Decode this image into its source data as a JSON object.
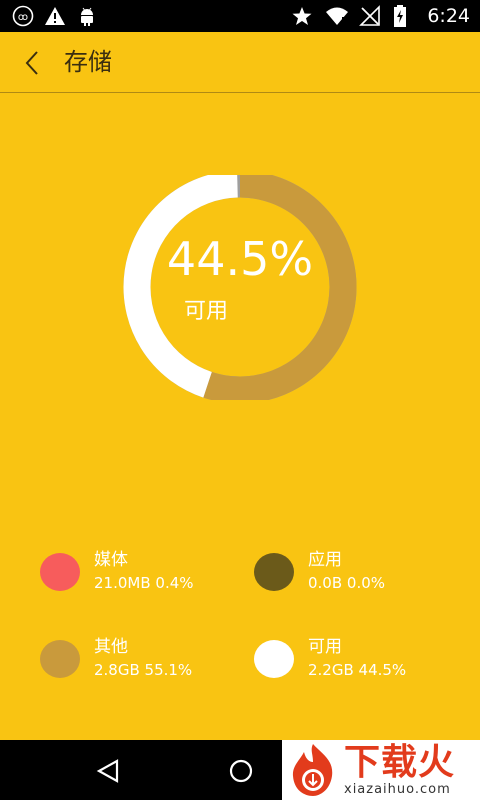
{
  "status_bar": {
    "time": "6:24",
    "icons_left": [
      "custom-app-icon",
      "warning-icon",
      "android-icon"
    ],
    "icons_right": [
      "star-icon",
      "wifi-icon",
      "no-signal-icon",
      "battery-charging-icon"
    ]
  },
  "header": {
    "title": "存储",
    "back_icon": "chevron-left-icon"
  },
  "storage_chart": {
    "percent_label": "44.5%",
    "available_label": "可用"
  },
  "chart_data": {
    "type": "pie",
    "categories": [
      "媒体",
      "应用",
      "其他",
      "可用"
    ],
    "values": [
      0.4,
      0.0,
      55.1,
      44.5
    ],
    "colors": [
      "#F75C5C",
      "#6B5A1A",
      "#C99A3C",
      "#FFFFFF"
    ]
  },
  "legend": [
    {
      "name": "媒体",
      "value": "21.0MB 0.4%",
      "color": "#F75C5C"
    },
    {
      "name": "应用",
      "value": "0.0B 0.0%",
      "color": "#6B5A1A"
    },
    {
      "name": "其他",
      "value": "2.8GB 55.1%",
      "color": "#C99A3C"
    },
    {
      "name": "可用",
      "value": "2.2GB 44.5%",
      "color": "#FFFFFF"
    }
  ],
  "colors": {
    "background": "#F9C412",
    "status_bar": "#000000",
    "chart_track": "#9E9E9E",
    "watermark_red": "#E23B1C"
  },
  "watermark": {
    "text": "下载火",
    "sub": "xiazaihuo.com"
  },
  "nav_bar": {
    "icons": [
      "nav-back-icon",
      "nav-home-icon"
    ]
  }
}
